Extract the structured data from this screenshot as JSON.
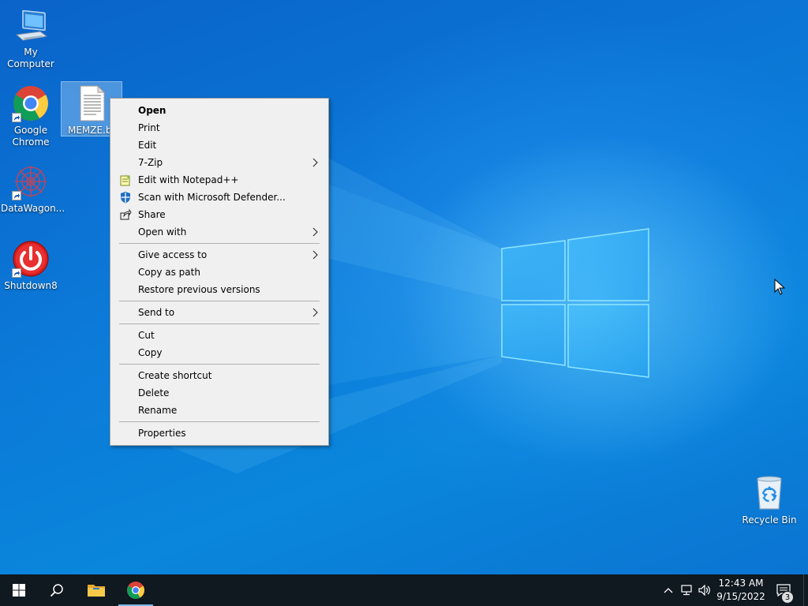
{
  "desktop": {
    "icons": [
      {
        "label": "My Computer",
        "icon": "computer-icon"
      },
      {
        "label": "Google Chrome",
        "icon": "chrome-icon"
      },
      {
        "label": "MEMZE.ba",
        "icon": "text-file-icon",
        "selected": true
      },
      {
        "label": "DataWagon...",
        "icon": "datawagon-icon"
      },
      {
        "label": "Shutdown8",
        "icon": "power-icon"
      },
      {
        "label": "Recycle Bin",
        "icon": "recycle-bin-icon"
      }
    ]
  },
  "context_menu": {
    "items": [
      {
        "label": "Open",
        "bold": true
      },
      {
        "label": "Print"
      },
      {
        "label": "Edit"
      },
      {
        "label": "7-Zip",
        "submenu": true
      },
      {
        "label": "Edit with Notepad++",
        "icon": "notepad-plus-plus-icon"
      },
      {
        "label": "Scan with Microsoft Defender...",
        "icon": "defender-shield-icon"
      },
      {
        "label": "Share",
        "icon": "share-icon"
      },
      {
        "label": "Open with",
        "submenu": true
      },
      {
        "label": "Give access to",
        "submenu": true
      },
      {
        "label": "Copy as path"
      },
      {
        "label": "Restore previous versions"
      },
      {
        "label": "Send to",
        "submenu": true
      },
      {
        "label": "Cut"
      },
      {
        "label": "Copy"
      },
      {
        "label": "Create shortcut"
      },
      {
        "label": "Delete"
      },
      {
        "label": "Rename"
      },
      {
        "label": "Properties"
      }
    ]
  },
  "taskbar": {
    "buttons": [
      {
        "name": "start",
        "icon": "windows-logo-icon"
      },
      {
        "name": "search",
        "icon": "search-icon"
      },
      {
        "name": "file-explorer",
        "icon": "folder-icon"
      },
      {
        "name": "chrome",
        "icon": "chrome-icon",
        "active": true
      }
    ],
    "tray": {
      "icons": [
        "chevron-up-icon",
        "network-icon",
        "volume-icon"
      ],
      "time": "12:43 AM",
      "date": "9/15/2022",
      "notification_count": "3"
    }
  },
  "colors": {
    "desktop_blue": "#0a78d4",
    "taskbar": "#101820",
    "menu_bg": "#f0f0f0"
  }
}
